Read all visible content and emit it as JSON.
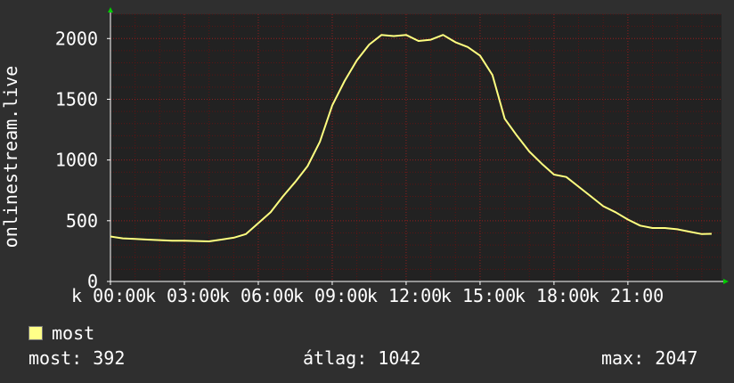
{
  "colors": {
    "background": "#2f2f2f",
    "plot_background": "#222222",
    "grid": "#5a1414",
    "axis": "#ffffff",
    "line": "#ffff80",
    "arrow": "#00cc00",
    "legend_swatch": "#ffff88"
  },
  "chart_data": {
    "type": "line",
    "title": "",
    "xlabel": "",
    "ylabel": "onlinestream.live",
    "ylim": [
      0,
      2200
    ],
    "y_ticks": [
      "0",
      "500",
      "1000",
      "1500",
      "2000"
    ],
    "y_tick_values": [
      0,
      500,
      1000,
      1500,
      2000
    ],
    "x_range_hours": [
      0,
      24.8
    ],
    "x_tick_labels": [
      "k 00:00",
      "k 03:00",
      "k 06:00",
      "k 09:00",
      "k 12:00",
      "k 15:00",
      "k 18:00",
      "k 21:00"
    ],
    "x_tick_hours": [
      0,
      3,
      6,
      9,
      12,
      15,
      18,
      21
    ],
    "grid": true,
    "legend": "bottom-left",
    "series": [
      {
        "name": "most",
        "x_hours": [
          0,
          0.5,
          1,
          1.5,
          2,
          2.5,
          3,
          3.5,
          4,
          4.5,
          5,
          5.5,
          6,
          6.5,
          7,
          7.5,
          8,
          8.5,
          9,
          9.5,
          10,
          10.5,
          11,
          11.5,
          12,
          12.5,
          13,
          13.5,
          14,
          14.5,
          15,
          15.5,
          16,
          16.5,
          17,
          17.5,
          18,
          18.5,
          19,
          19.5,
          20,
          20.5,
          21,
          21.5,
          22,
          22.5,
          23,
          23.5,
          24,
          24.4
        ],
        "values": [
          370,
          355,
          350,
          345,
          340,
          335,
          335,
          333,
          330,
          345,
          360,
          390,
          480,
          570,
          700,
          820,
          950,
          1150,
          1450,
          1650,
          1820,
          1950,
          2030,
          2020,
          2030,
          1980,
          1990,
          2030,
          1970,
          1930,
          1860,
          1700,
          1340,
          1200,
          1070,
          970,
          880,
          860,
          780,
          700,
          620,
          570,
          510,
          460,
          440,
          440,
          430,
          410,
          390,
          392
        ]
      }
    ]
  },
  "legend": {
    "label": "most"
  },
  "stats": {
    "current": "most: 392",
    "average": "átlag: 1042",
    "maximum": "max: 2047"
  }
}
